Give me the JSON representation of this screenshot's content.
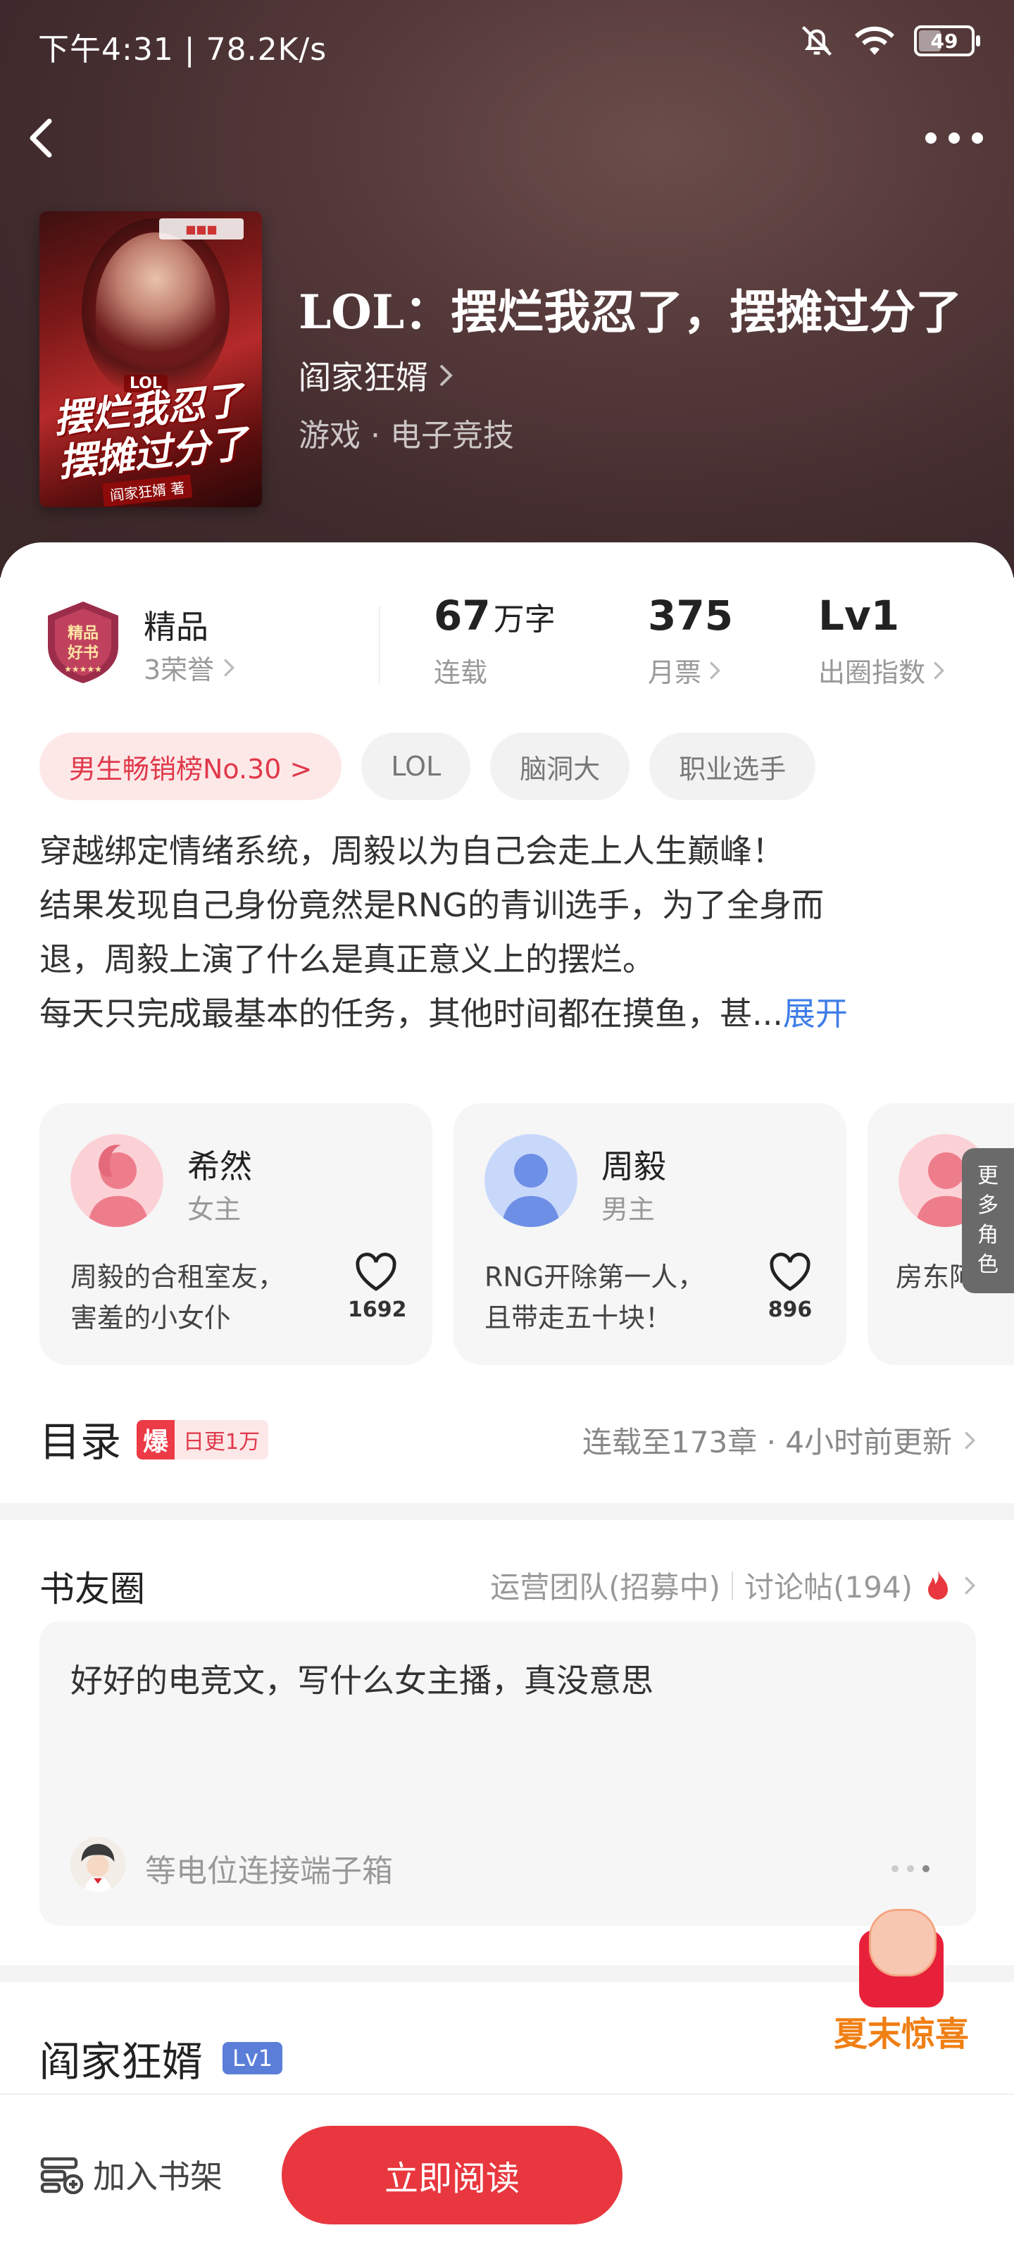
{
  "status_bar": {
    "time_speed": "下午4:31 | 78.2K/s",
    "battery": "49"
  },
  "book": {
    "title": "LOL：摆烂我忍了，摆摊过分了",
    "author": "阎家狂婿",
    "genre": "游戏 · 电子竞技",
    "cover_title_top": "摆烂我忍了",
    "cover_title_bottom": "摆摊过分了",
    "cover_small": "LOL",
    "cover_author": "阎家狂婿 著"
  },
  "stats": {
    "badge_title": "精品",
    "badge_sub": "3荣誉",
    "badge_emblem_top": "精品",
    "badge_emblem_bottom": "好书",
    "words_num": "67",
    "words_unit": "万字",
    "words_label": "连载",
    "tickets_num": "375",
    "tickets_label": "月票",
    "index_num": "Lv1",
    "index_label": "出圈指数"
  },
  "tags": [
    "男生畅销榜No.30 >",
    "LOL",
    "脑洞大",
    "职业选手"
  ],
  "synopsis": {
    "lines": [
      "穿越绑定情绪系统，周毅以为自己会走上人生巅峰！",
      "结果发现自己身份竟然是RNG的青训选手，为了全身而",
      "退，周毅上演了什么是真正意义上的摆烂。",
      "每天只完成最基本的任务，其他时间都在摸鱼，甚..."
    ],
    "expand": "展开"
  },
  "roles": [
    {
      "name": "希然",
      "type": "女主",
      "desc_1": "周毅的合租室友，",
      "desc_2": "害羞的小女仆",
      "likes": "1692"
    },
    {
      "name": "周毅",
      "type": "男主",
      "desc_1": "RNG开除第一人，",
      "desc_2": "且带走五十块！",
      "likes": "896"
    },
    {
      "name": "",
      "type": "",
      "desc_1": "",
      "desc_2": "房东阿姨",
      "likes": ""
    }
  ],
  "more_roles": "更多角色",
  "catalog": {
    "title": "目录",
    "hot": "爆",
    "daily": "日更1万",
    "status": "连载至173章 · 4小时前更新"
  },
  "circle": {
    "title": "书友圈",
    "team": "运营团队(招募中)",
    "posts": "讨论帖(194)",
    "post_text": "好好的电竞文，写什么女主播，真没意思",
    "post_user": "等电位连接端子箱"
  },
  "author_section": {
    "name": "阎家狂婿",
    "level": "Lv1"
  },
  "promo": {
    "text": "夏末惊喜"
  },
  "bottom": {
    "shelf": "加入书架",
    "read": "立即阅读"
  },
  "colors": {
    "accent_red": "#e8373e",
    "link_blue": "#3f7de8",
    "header_bg": "#4a3233"
  }
}
